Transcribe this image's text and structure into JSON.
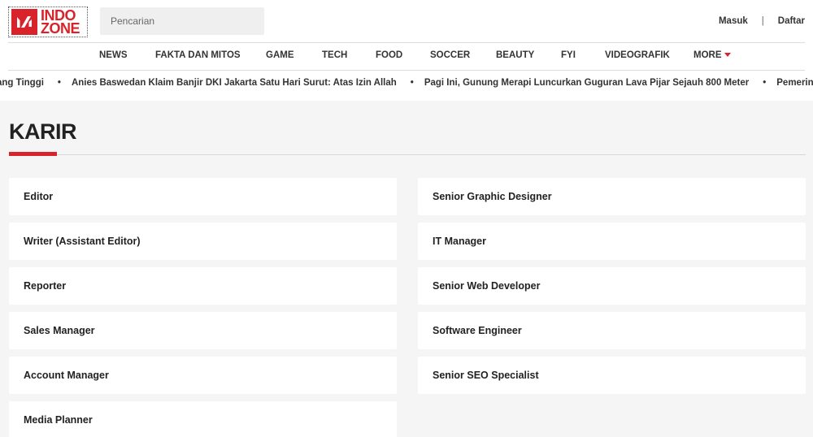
{
  "brand": {
    "line1": "INDO",
    "line2": "ZONE",
    "accent_color": "#d8232a"
  },
  "search": {
    "placeholder": "Pencarian"
  },
  "auth": {
    "login": "Masuk",
    "separator": "|",
    "register": "Daftar"
  },
  "nav": {
    "items": [
      {
        "label": "NEWS"
      },
      {
        "label": "FAKTA DAN MITOS"
      },
      {
        "label": "GAME"
      },
      {
        "label": "TECH"
      },
      {
        "label": "FOOD"
      },
      {
        "label": "SOCCER"
      },
      {
        "label": "BEAUTY"
      },
      {
        "label": "FYI"
      },
      {
        "label": "VIDEOGRAFIK"
      },
      {
        "label": "MORE"
      }
    ]
  },
  "ticker": {
    "items": [
      "ang Tinggi",
      "Anies Baswedan Klaim Banjir DKI Jakarta Satu Hari Surut: Atas Izin Allah",
      "Pagi Ini, Gunung Merapi Luncurkan Guguran Lava Pijar Sejauh 800 Meter",
      "Pemerintah Klaim"
    ]
  },
  "page": {
    "title": "KARIR"
  },
  "careers": {
    "left": [
      "Editor",
      "Writer (Assistant Editor)",
      "Reporter",
      "Sales Manager",
      "Account Manager",
      "Media Planner"
    ],
    "right": [
      "Senior Graphic Designer",
      "IT Manager",
      "Senior Web Developer",
      "Software Engineer",
      "Senior SEO Specialist"
    ]
  }
}
